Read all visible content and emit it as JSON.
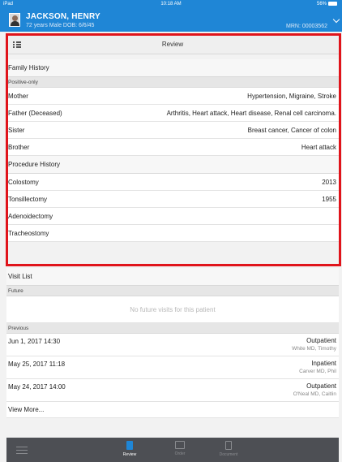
{
  "status_bar": {
    "carrier": "iPad",
    "time": "10:18 AM",
    "battery": "56%"
  },
  "patient": {
    "name": "JACKSON, HENRY",
    "details": "72 years  Male  DOB: 6/6/45",
    "mrn": "MRN: 00003562"
  },
  "review": {
    "title": "Review"
  },
  "family_history": {
    "title": "Family History",
    "filter": "Positive-only",
    "rows": [
      {
        "relation": "Mother",
        "conditions": "Hypertension, Migraine, Stroke"
      },
      {
        "relation": "Father (Deceased)",
        "conditions": "Arthritis, Heart attack, Heart disease, Renal cell carcinoma."
      },
      {
        "relation": "Sister",
        "conditions": "Breast cancer, Cancer of colon"
      },
      {
        "relation": "Brother",
        "conditions": "Heart attack"
      }
    ]
  },
  "procedure_history": {
    "title": "Procedure History",
    "rows": [
      {
        "procedure": "Colostomy",
        "year": "2013"
      },
      {
        "procedure": "Tonsillectomy",
        "year": "1955"
      },
      {
        "procedure": "Adenoidectomy",
        "year": ""
      },
      {
        "procedure": "Tracheostomy",
        "year": ""
      }
    ]
  },
  "visit_list": {
    "title": "Visit List",
    "future_label": "Future",
    "future_empty": "No future visits for this patient",
    "previous_label": "Previous",
    "visits": [
      {
        "date": "Jun 1, 2017 14:30",
        "type": "Outpatient",
        "provider": "White MD, Timothy"
      },
      {
        "date": "May 25, 2017 11:18",
        "type": "Inpatient",
        "provider": "Carver MD, Phil"
      },
      {
        "date": "May 24, 2017 14:00",
        "type": "Outpatient",
        "provider": "O'Neal MD, Caitlin"
      }
    ],
    "view_more": "View More..."
  },
  "tabs": [
    {
      "label": "Review",
      "icon": "review-icon",
      "active": true
    },
    {
      "label": "Order",
      "icon": "order-icon",
      "active": false
    },
    {
      "label": "Document",
      "icon": "document-icon",
      "active": false
    }
  ],
  "colors": {
    "header_blue": "#1f86d6",
    "highlight_red": "#e0141b",
    "tab_bar": "#4d4f54"
  }
}
